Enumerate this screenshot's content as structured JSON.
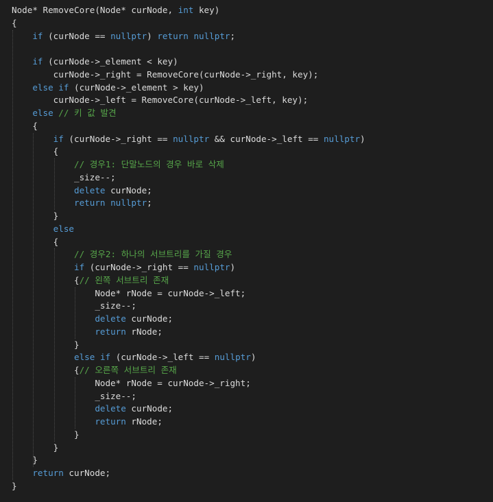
{
  "colors": {
    "background": "#1e1e1e",
    "text": "#dcdcdc",
    "keyword": "#569cd6",
    "comment": "#57a64a",
    "indent_guide": "#4b4b4b"
  },
  "code": {
    "lines": [
      [
        [
          "tx",
          "Node* RemoveCore(Node* curNode, "
        ],
        [
          "kw",
          "int"
        ],
        [
          "tx",
          " key)"
        ]
      ],
      [
        [
          "tx",
          "{"
        ]
      ],
      [
        [
          "tx",
          "    "
        ],
        [
          "kw",
          "if"
        ],
        [
          "tx",
          " (curNode == "
        ],
        [
          "kw",
          "nullptr"
        ],
        [
          "tx",
          ") "
        ],
        [
          "kw",
          "return"
        ],
        [
          "tx",
          " "
        ],
        [
          "kw",
          "nullptr"
        ],
        [
          "tx",
          ";"
        ]
      ],
      [],
      [
        [
          "tx",
          "    "
        ],
        [
          "kw",
          "if"
        ],
        [
          "tx",
          " (curNode->_element < key)"
        ]
      ],
      [
        [
          "tx",
          "        curNode->_right = RemoveCore(curNode->_right, key);"
        ]
      ],
      [
        [
          "tx",
          "    "
        ],
        [
          "kw",
          "else"
        ],
        [
          "tx",
          " "
        ],
        [
          "kw",
          "if"
        ],
        [
          "tx",
          " (curNode->_element > key)"
        ]
      ],
      [
        [
          "tx",
          "        curNode->_left = RemoveCore(curNode->_left, key);"
        ]
      ],
      [
        [
          "tx",
          "    "
        ],
        [
          "kw",
          "else"
        ],
        [
          "tx",
          " "
        ],
        [
          "cm",
          "// 키 값 발견"
        ]
      ],
      [
        [
          "tx",
          "    {"
        ]
      ],
      [
        [
          "tx",
          "        "
        ],
        [
          "kw",
          "if"
        ],
        [
          "tx",
          " (curNode->_right == "
        ],
        [
          "kw",
          "nullptr"
        ],
        [
          "tx",
          " && curNode->_left == "
        ],
        [
          "kw",
          "nullptr"
        ],
        [
          "tx",
          ")"
        ]
      ],
      [
        [
          "tx",
          "        {"
        ]
      ],
      [
        [
          "tx",
          "            "
        ],
        [
          "cm",
          "// 경우1: 단말노드의 경우 바로 삭제"
        ]
      ],
      [
        [
          "tx",
          "            _size--;"
        ]
      ],
      [
        [
          "tx",
          "            "
        ],
        [
          "kw",
          "delete"
        ],
        [
          "tx",
          " curNode;"
        ]
      ],
      [
        [
          "tx",
          "            "
        ],
        [
          "kw",
          "return"
        ],
        [
          "tx",
          " "
        ],
        [
          "kw",
          "nullptr"
        ],
        [
          "tx",
          ";"
        ]
      ],
      [
        [
          "tx",
          "        }"
        ]
      ],
      [
        [
          "tx",
          "        "
        ],
        [
          "kw",
          "else"
        ]
      ],
      [
        [
          "tx",
          "        {"
        ]
      ],
      [
        [
          "tx",
          "            "
        ],
        [
          "cm",
          "// 경우2: 하나의 서브트리를 가질 경우"
        ]
      ],
      [
        [
          "tx",
          "            "
        ],
        [
          "kw",
          "if"
        ],
        [
          "tx",
          " (curNode->_right == "
        ],
        [
          "kw",
          "nullptr"
        ],
        [
          "tx",
          ")"
        ]
      ],
      [
        [
          "tx",
          "            {"
        ],
        [
          "cm",
          "// 왼쪽 서브트리 존재"
        ]
      ],
      [
        [
          "tx",
          "                Node* rNode = curNode->_left;"
        ]
      ],
      [
        [
          "tx",
          "                _size--;"
        ]
      ],
      [
        [
          "tx",
          "                "
        ],
        [
          "kw",
          "delete"
        ],
        [
          "tx",
          " curNode;"
        ]
      ],
      [
        [
          "tx",
          "                "
        ],
        [
          "kw",
          "return"
        ],
        [
          "tx",
          " rNode;"
        ]
      ],
      [
        [
          "tx",
          "            }"
        ]
      ],
      [
        [
          "tx",
          "            "
        ],
        [
          "kw",
          "else"
        ],
        [
          "tx",
          " "
        ],
        [
          "kw",
          "if"
        ],
        [
          "tx",
          " (curNode->_left == "
        ],
        [
          "kw",
          "nullptr"
        ],
        [
          "tx",
          ")"
        ]
      ],
      [
        [
          "tx",
          "            {"
        ],
        [
          "cm",
          "// 오른쪽 서브트리 존재"
        ]
      ],
      [
        [
          "tx",
          "                Node* rNode = curNode->_right;"
        ]
      ],
      [
        [
          "tx",
          "                _size--;"
        ]
      ],
      [
        [
          "tx",
          "                "
        ],
        [
          "kw",
          "delete"
        ],
        [
          "tx",
          " curNode;"
        ]
      ],
      [
        [
          "tx",
          "                "
        ],
        [
          "kw",
          "return"
        ],
        [
          "tx",
          " rNode;"
        ]
      ],
      [
        [
          "tx",
          "            }"
        ]
      ],
      [
        [
          "tx",
          "        }"
        ]
      ],
      [
        [
          "tx",
          "    }"
        ]
      ],
      [
        [
          "tx",
          "    "
        ],
        [
          "kw",
          "return"
        ],
        [
          "tx",
          " curNode;"
        ]
      ],
      [
        [
          "tx",
          "}"
        ]
      ]
    ]
  }
}
